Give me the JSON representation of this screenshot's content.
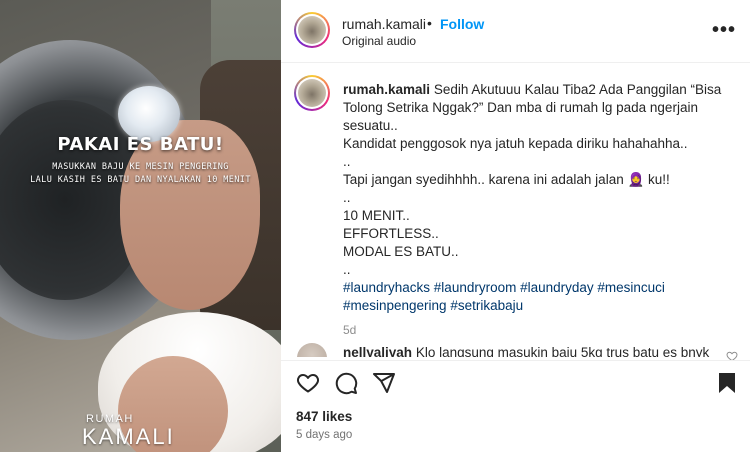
{
  "media": {
    "overlay_title": "PAKAI ES BATU!",
    "overlay_line1": "MASUKKAN BAJU KE MESIN PENGERING",
    "overlay_line2": "LALU KASIH ES BATU DAN NYALAKAN 10 MENIT",
    "brand_top": "RUMAH",
    "brand_bottom": "KAMALI"
  },
  "header": {
    "username": "rumah.kamali",
    "separator": "•",
    "follow_label": "Follow",
    "audio": "Original audio",
    "more_label": "•••"
  },
  "caption": {
    "username": "rumah.kamali",
    "first_line": "Sedih Akutuuu Kalau Tiba2 Ada Panggilan “Bisa Tolong Setrika Nggak?” Dan mba di rumah lg pada ngerjain sesuatu..",
    "lines": [
      "Kandidat penggosok nya jatuh kepada diriku hahahahha..",
      "..",
      "Tapi jangan syedihhhh.. karena ini adalah jalan 🧕 ku!!",
      "..",
      "10 MENIT..",
      "EFFORTLESS..",
      "MODAL ES BATU..",
      ".."
    ],
    "hashtags_line1": "#laundryhacks #laundryroom #laundryday #mesincuci",
    "hashtags_line2": "#mesinpengering #setrikabaju",
    "age": "5d"
  },
  "comment": {
    "username": "nellyaliyah",
    "text": "Klo langsung masukin baju 5kg trus batu es bnyk"
  },
  "actions": {
    "like_icon": "heart-icon",
    "comment_icon": "comment-icon",
    "share_icon": "share-icon",
    "save_icon": "bookmark-icon"
  },
  "footer": {
    "likes": "847 likes",
    "date": "5 days ago"
  },
  "colors": {
    "accent": "#0095f6",
    "hashtag": "#00376b",
    "muted": "#8e8e8e"
  }
}
